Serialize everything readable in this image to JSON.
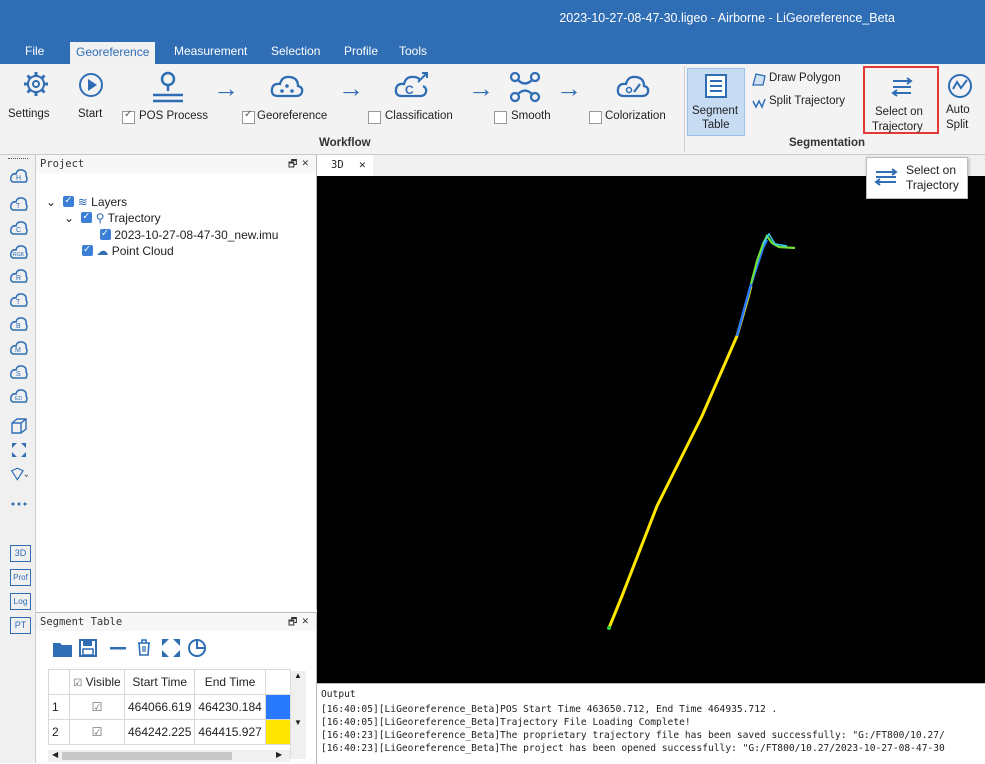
{
  "window": {
    "title": "2023-10-27-08-47-30.ligeo - Airborne - LiGeoreference_Beta"
  },
  "menu": [
    "File",
    "Georeference",
    "Measurement",
    "Selection",
    "Profile",
    "Tools"
  ],
  "ribbon": {
    "settings": "Settings",
    "start": "Start",
    "pos_process": "POS Process",
    "georeference": "Georeference",
    "classification": "Classification",
    "smooth": "Smooth",
    "colorization": "Colorization",
    "workflow_group": "Workflow",
    "segment_table_line1": "Segment",
    "segment_table_line2": "Table",
    "draw_polygon": "Draw Polygon",
    "split_trajectory": "Split Trajectory",
    "select_on_line1": "Select on",
    "select_on_line2": "Trajectory",
    "auto_split_line1": "Auto",
    "auto_split_line2": "Split",
    "segmentation_group": "Segmentation",
    "checks": {
      "pos_process": true,
      "georeference": true,
      "classification": false,
      "smooth": false,
      "colorization": false
    }
  },
  "tooltip": {
    "line1": "Select on",
    "line2": "Trajectory"
  },
  "left_toolbar": {
    "tab_3d": "3D",
    "tab_prof": "Prof",
    "tab_log": "Log",
    "tab_pt": "PT"
  },
  "project": {
    "title": "Project",
    "tree": {
      "layers": "Layers",
      "trajectory": "Trajectory",
      "imu_file": "2023-10-27-08-47-30_new.imu",
      "point_cloud": "Point Cloud"
    }
  },
  "segment_table": {
    "title": "Segment Table",
    "columns": [
      "Visible",
      "Start Time",
      "End Time"
    ],
    "rows": [
      {
        "index": "1",
        "visible": true,
        "start": "464066.619",
        "end": "464230.184",
        "color": "#2979ff"
      },
      {
        "index": "2",
        "visible": true,
        "start": "464242.225",
        "end": "464415.927",
        "color": "#ffe600"
      }
    ]
  },
  "viewer": {
    "tab": "3D"
  },
  "output": {
    "title": "Output",
    "lines": [
      "[16:40:05][LiGeoreference_Beta]POS Start Time 463650.712, End Time 464935.712 .",
      "[16:40:05][LiGeoreference_Beta]Trajectory File Loading Complete!",
      "[16:40:23][LiGeoreference_Beta]The proprietary trajectory file has been saved successfully: \"G:/FT800/10.27/",
      "[16:40:23][LiGeoreference_Beta]The project has been opened successfully: \"G:/FT800/10.27/2023-10-27-08-47-30"
    ]
  },
  "colors": {
    "accent": "#2f6db5",
    "highlight_border": "#e53935"
  }
}
